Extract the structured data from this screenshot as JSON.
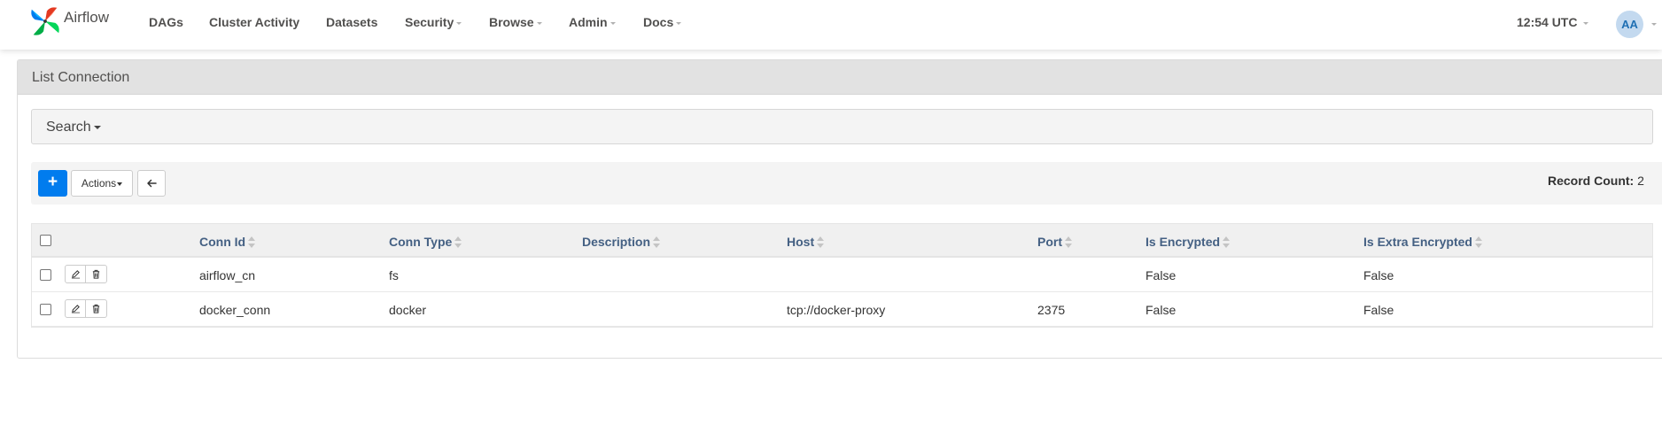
{
  "brand": {
    "name": "Airflow"
  },
  "nav": {
    "dags": "DAGs",
    "cluster_activity": "Cluster Activity",
    "datasets": "Datasets",
    "security": "Security",
    "browse": "Browse",
    "admin": "Admin",
    "docs": "Docs"
  },
  "header": {
    "clock": "12:54 UTC",
    "avatar_initials": "AA"
  },
  "panel": {
    "title": "List Connection"
  },
  "search": {
    "label": "Search"
  },
  "toolbar": {
    "add_label": "+",
    "actions_label": "Actions",
    "back_icon": "arrow-left-icon",
    "record_count_label": "Record Count:",
    "record_count_value": "2"
  },
  "table": {
    "columns": [
      "Conn Id",
      "Conn Type",
      "Description",
      "Host",
      "Port",
      "Is Encrypted",
      "Is Extra Encrypted"
    ],
    "rows": [
      {
        "conn_id": "airflow_cn",
        "conn_type": "fs",
        "description": "",
        "host": "",
        "port": "",
        "is_encrypted": "False",
        "is_extra_encrypted": "False"
      },
      {
        "conn_id": "docker_conn",
        "conn_type": "docker",
        "description": "",
        "host": "tcp://docker-proxy",
        "port": "2375",
        "is_encrypted": "False",
        "is_extra_encrypted": "False"
      }
    ]
  },
  "colors": {
    "accent": "#017cee",
    "header_text": "#446083",
    "panel_heading": "#e2e2e2"
  }
}
